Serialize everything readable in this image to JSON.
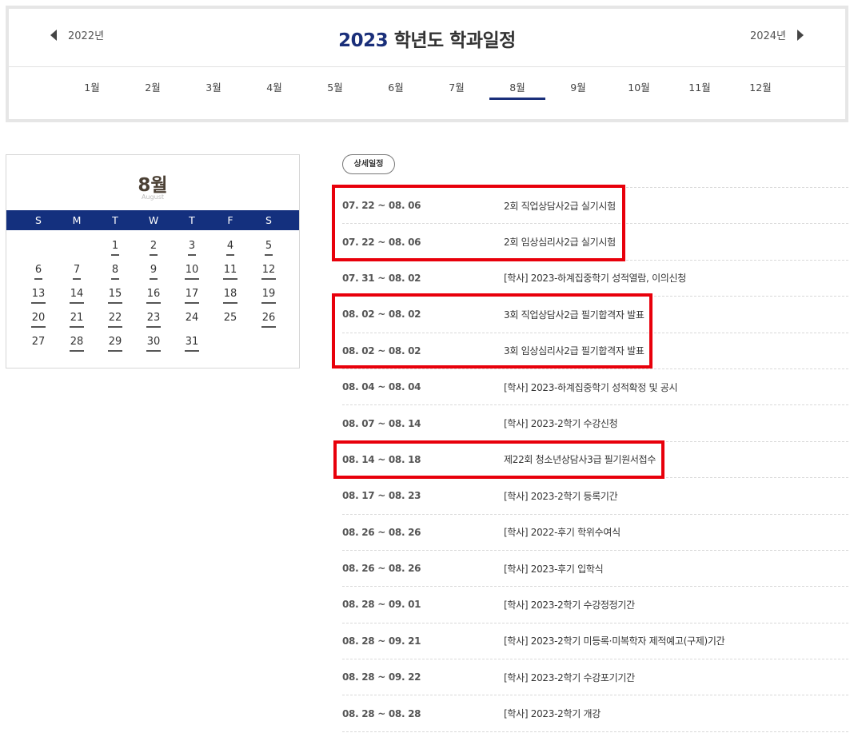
{
  "header": {
    "prev_year": "2022년",
    "next_year": "2024년",
    "title_year": "2023",
    "title_suffix": " 학년도 학과일정",
    "months": [
      "1월",
      "2월",
      "3월",
      "4월",
      "5월",
      "6월",
      "7월",
      "8월",
      "9월",
      "10월",
      "11월",
      "12월"
    ],
    "active_month": "8월"
  },
  "calendar": {
    "title": "8월",
    "subtitle": "August",
    "weekdays": [
      "S",
      "M",
      "T",
      "W",
      "T",
      "F",
      "S"
    ],
    "weeks": [
      [
        "",
        "",
        "1",
        "2",
        "3",
        "4",
        "5"
      ],
      [
        "6",
        "7",
        "8",
        "9",
        "10",
        "11",
        "12"
      ],
      [
        "13",
        "14",
        "15",
        "16",
        "17",
        "18",
        "19"
      ],
      [
        "20",
        "21",
        "22",
        "23",
        "24",
        "25",
        "26"
      ],
      [
        "27",
        "28",
        "29",
        "30",
        "31",
        "",
        ""
      ]
    ],
    "event_days": [
      "1",
      "2",
      "3",
      "4",
      "5",
      "6",
      "7",
      "8",
      "9",
      "10",
      "11",
      "12",
      "13",
      "14",
      "15",
      "16",
      "17",
      "18",
      "19",
      "20",
      "21",
      "22",
      "23",
      "26",
      "28",
      "29",
      "30",
      "31"
    ]
  },
  "schedule": {
    "detail_button": "상세일정",
    "rows": [
      {
        "date": "07. 22 ~ 08. 06",
        "title": "2회 직업상담사2급 실기시험"
      },
      {
        "date": "07. 22 ~ 08. 06",
        "title": "2회 임상심리사2급 실기시험"
      },
      {
        "date": "07. 31 ~ 08. 02",
        "title": "[학사] 2023-하계집중학기 성적열람, 이의신청"
      },
      {
        "date": "08. 02 ~ 08. 02",
        "title": "3회 직업상담사2급 필기합격자 발표"
      },
      {
        "date": "08. 02 ~ 08. 02",
        "title": "3회 임상심리사2급 필기합격자 발표"
      },
      {
        "date": "08. 04 ~ 08. 04",
        "title": "[학사] 2023-하계집중학기 성적확정 및 공시"
      },
      {
        "date": "08. 07 ~ 08. 14",
        "title": "[학사] 2023-2학기 수강신청"
      },
      {
        "date": "08. 14 ~ 08. 18",
        "title": "제22회 청소년상담사3급 필기원서접수"
      },
      {
        "date": "08. 17 ~ 08. 23",
        "title": "[학사] 2023-2학기 등록기간"
      },
      {
        "date": "08. 26 ~ 08. 26",
        "title": "[학사] 2022-후기 학위수여식"
      },
      {
        "date": "08. 26 ~ 08. 26",
        "title": "[학사] 2023-후기 입학식"
      },
      {
        "date": "08. 28 ~ 09. 01",
        "title": "[학사] 2023-2학기 수강정정기간"
      },
      {
        "date": "08. 28 ~ 09. 21",
        "title": "[학사] 2023-2학기 미등록·미복학자 제적예고(구제)기간"
      },
      {
        "date": "08. 28 ~ 09. 22",
        "title": "[학사] 2023-2학기 수강포기기간"
      },
      {
        "date": "08. 28 ~ 08. 28",
        "title": "[학사] 2023-2학기 개강"
      }
    ]
  },
  "highlight_color": "#e8000b",
  "accent_color": "#14307e"
}
